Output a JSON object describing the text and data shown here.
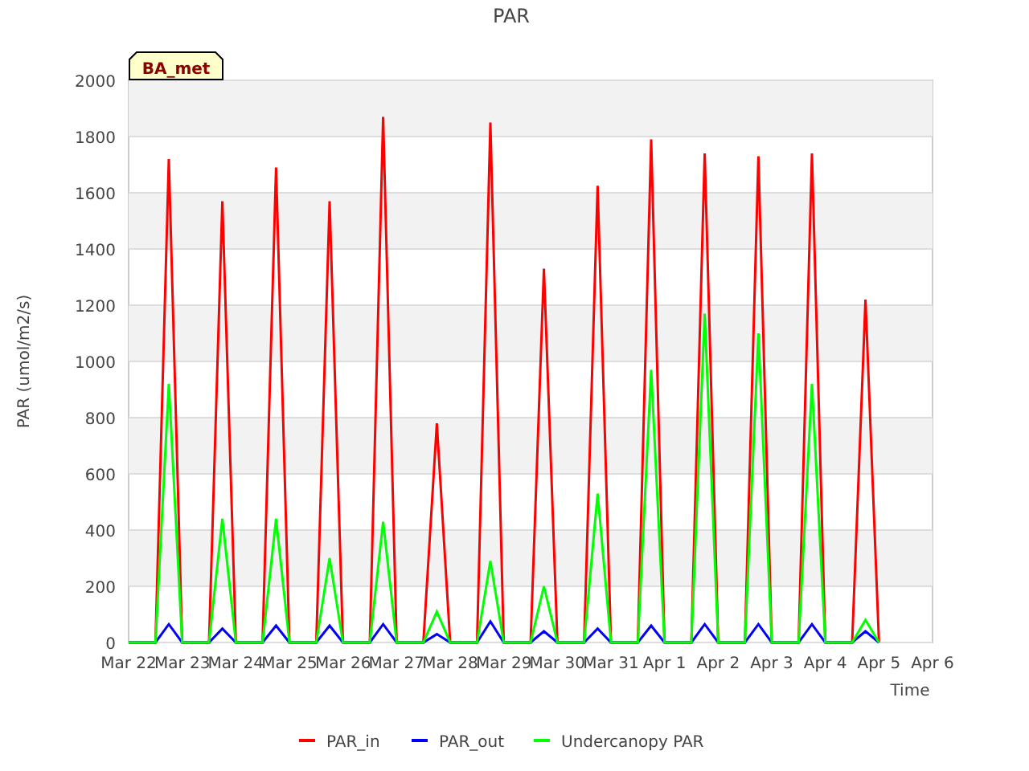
{
  "tag": "BA_met",
  "chart_data": {
    "type": "line",
    "title": "PAR",
    "xlabel": "Time",
    "ylabel": "PAR (umol/m2/s)",
    "categories": [
      "Mar 22",
      null,
      null,
      null,
      "Mar 23",
      null,
      null,
      null,
      "Mar 24",
      null,
      null,
      null,
      "Mar 25",
      null,
      null,
      null,
      "Mar 26",
      null,
      null,
      null,
      "Mar 27",
      null,
      null,
      null,
      "Mar 28",
      null,
      null,
      null,
      "Mar 29",
      null,
      null,
      null,
      "Mar 30",
      null,
      null,
      null,
      "Mar 31",
      null,
      null,
      null,
      "Apr 1",
      null,
      null,
      null,
      "Apr 2",
      null,
      null,
      null,
      "Apr 3",
      null,
      null,
      null,
      "Apr 4",
      null,
      null,
      null,
      "Apr 5",
      null,
      null,
      null,
      "Apr 6"
    ],
    "series": [
      {
        "name": "PAR_in",
        "color": "#ff0000",
        "values": [
          0,
          0,
          0,
          1720,
          0,
          0,
          0,
          1570,
          0,
          0,
          0,
          1690,
          0,
          0,
          0,
          1570,
          0,
          0,
          0,
          1870,
          0,
          0,
          0,
          780,
          0,
          0,
          0,
          1850,
          0,
          0,
          0,
          1330,
          0,
          0,
          0,
          1625,
          0,
          0,
          0,
          1790,
          0,
          0,
          0,
          1740,
          0,
          0,
          0,
          1730,
          0,
          0,
          0,
          1740,
          0,
          0,
          0,
          1220,
          0,
          null,
          null,
          null,
          null
        ]
      },
      {
        "name": "PAR_out",
        "color": "#0000ff",
        "values": [
          0,
          0,
          0,
          65,
          0,
          0,
          0,
          50,
          0,
          0,
          0,
          60,
          0,
          0,
          0,
          60,
          0,
          0,
          0,
          65,
          0,
          0,
          0,
          30,
          0,
          0,
          0,
          75,
          0,
          0,
          0,
          40,
          0,
          0,
          0,
          50,
          0,
          0,
          0,
          60,
          0,
          0,
          0,
          65,
          0,
          0,
          0,
          65,
          0,
          0,
          0,
          65,
          0,
          0,
          0,
          40,
          0,
          null,
          null,
          null,
          null
        ]
      },
      {
        "name": "Undercanopy PAR",
        "color": "#00ff00",
        "values": [
          0,
          0,
          0,
          920,
          0,
          0,
          0,
          440,
          0,
          0,
          0,
          440,
          0,
          0,
          0,
          300,
          0,
          0,
          0,
          430,
          0,
          0,
          0,
          110,
          0,
          0,
          0,
          290,
          0,
          0,
          0,
          200,
          0,
          0,
          0,
          530,
          0,
          0,
          0,
          970,
          0,
          0,
          0,
          1170,
          0,
          0,
          0,
          1100,
          0,
          0,
          0,
          920,
          0,
          0,
          0,
          80,
          0,
          null,
          null,
          null,
          null
        ]
      }
    ],
    "ylim": [
      0,
      2000
    ],
    "grid": true,
    "legend": "bottom",
    "yticks": [
      0,
      200,
      400,
      600,
      800,
      1000,
      1200,
      1400,
      1600,
      1800,
      2000
    ]
  }
}
